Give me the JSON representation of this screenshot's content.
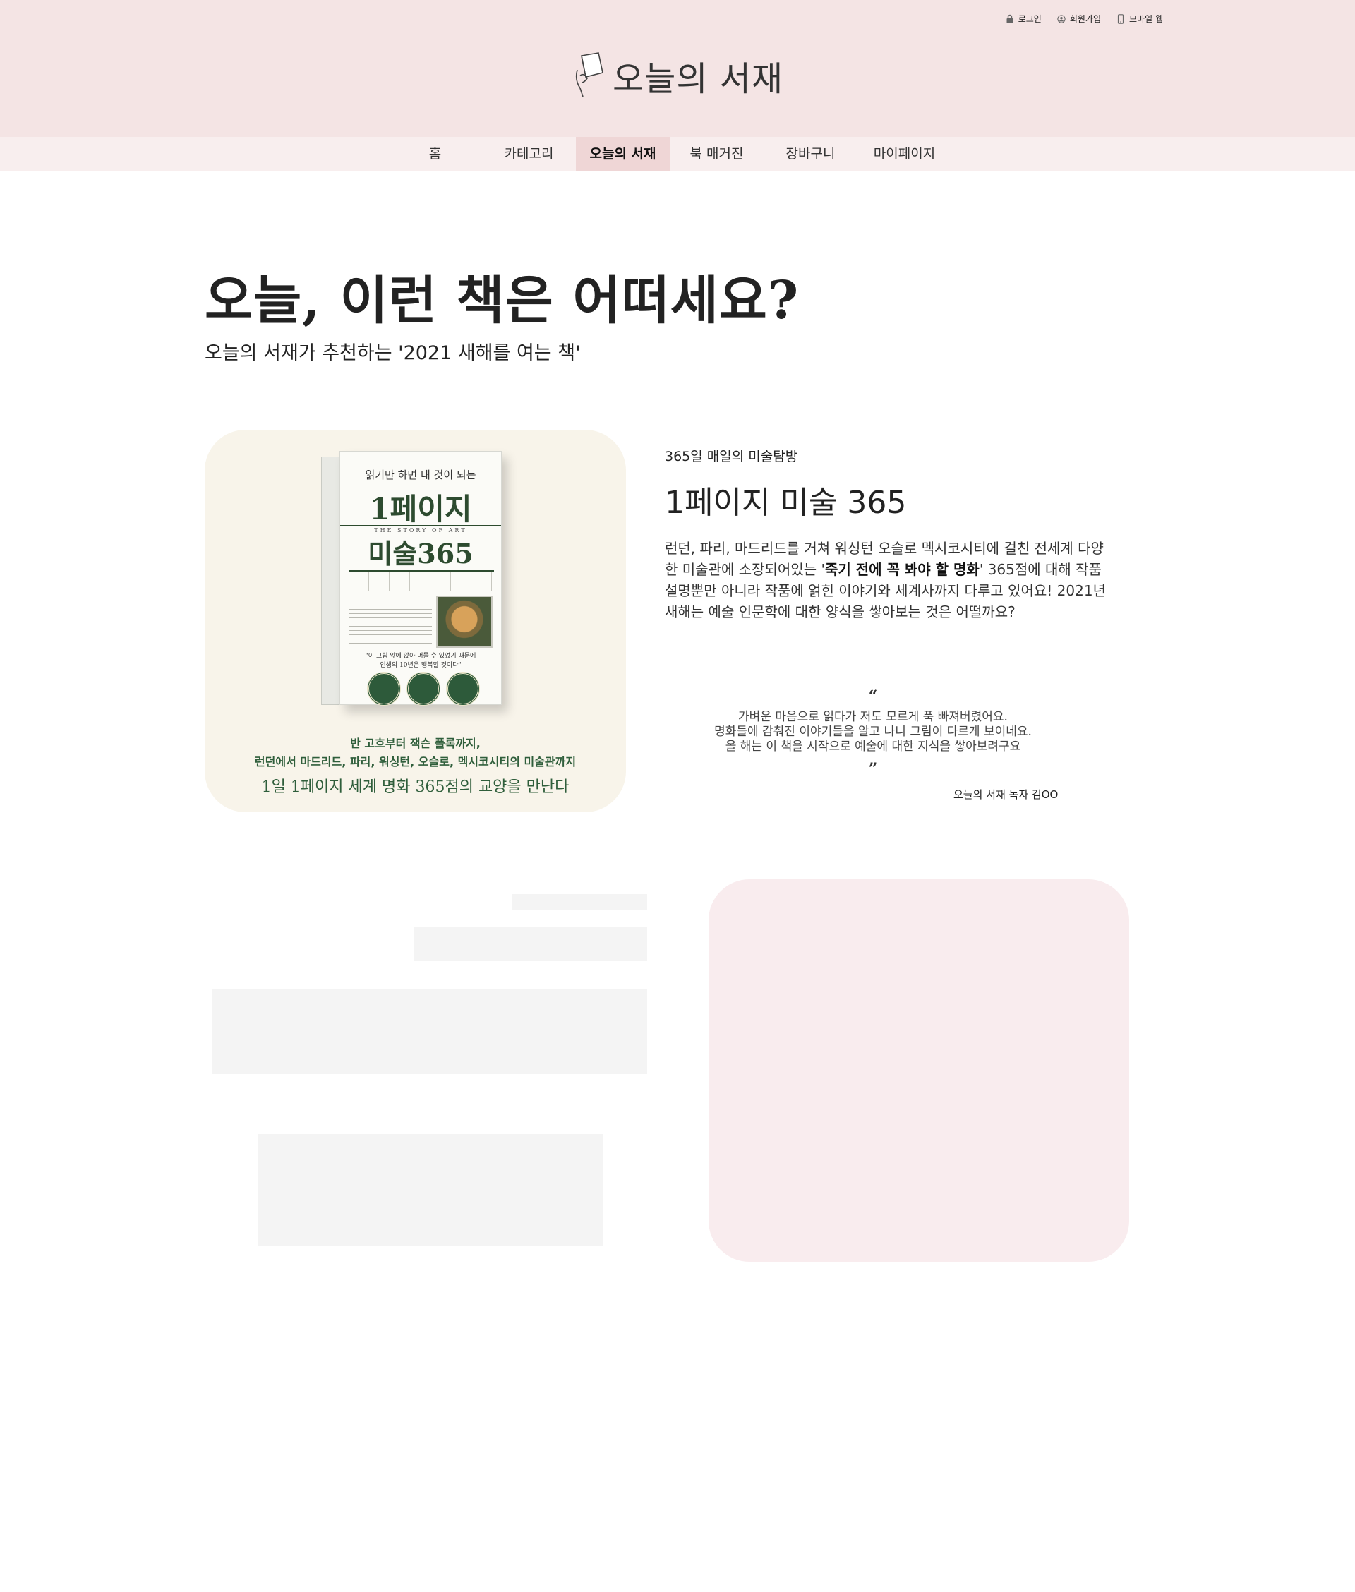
{
  "utility": {
    "login": "로그인",
    "signup": "회원가입",
    "mobile": "모바일 웹"
  },
  "logo": {
    "text": "오늘의 서재",
    "icon": "book-hand-icon"
  },
  "nav": {
    "items": [
      {
        "label": "홈"
      },
      {
        "label": "카테고리"
      },
      {
        "label": "오늘의 서재",
        "active": true
      },
      {
        "label": "북 매거진"
      },
      {
        "label": "장바구니"
      },
      {
        "label": "마이페이지"
      }
    ]
  },
  "hero": {
    "headline": "오늘, 이런 책은 어떠세요?",
    "subline": "오늘의 서재가 추천하는 '2021 새해를 여는 책'"
  },
  "book_cover": {
    "top_line": "읽기만 하면 내 것이 되는",
    "title_line1": "1페이지",
    "subtitle": "THE STORY OF ART",
    "title_line2": "미술365",
    "quote": "\"이 그림 앞에 앉아 머물 수 있었기 때문에\n인생의 10년은 행복할 것이다\"",
    "promo_line1": "반 고흐부터 잭슨 폴록까지,",
    "promo_line2": "런던에서 마드리드, 파리, 워싱턴, 오슬로, 멕시코시티의 미술관까지",
    "promo_line3": "1일 1페이지 세계 명화 365점의 교양을 만난다"
  },
  "book": {
    "kicker": "365일 매일의 미술탐방",
    "title": "1페이지 미술 365",
    "desc_part1": "런던, 파리, 마드리드를 거쳐 워싱턴 오슬로 멕시코시티에 걸친 전세계 다양한 미술관에 소장되어있는 '",
    "desc_bold": "죽기 전에 꼭 봐야 할 명화",
    "desc_part2": "' 365점에 대해 작품 설명뿐만 아니라 작품에 얽힌 이야기와 세계사까지 다루고 있어요! 2021년 새해는 예술 인문학에 대한 양식을 쌓아보는 것은 어떨까요?"
  },
  "review": {
    "open_quote": "“",
    "line1": "가벼운 마음으로 읽다가 저도 모르게 푹 빠져버렸어요.",
    "line2": "명화들에 감춰진 이야기들을 알고 나니 그림이 다르게 보이네요.",
    "line3": "올 해는 이 책을 시작으로 예술에 대한 지식을 쌓아보려구요",
    "close_quote": "”",
    "reviewer": "오늘의 서재 독자 김OO"
  },
  "colors": {
    "header_bg": "#f4e4e4",
    "nav_bg": "#f8eeee",
    "nav_active": "#efd6d6",
    "placeholder": "#f4f4f4",
    "pink_card": "#f9ecee",
    "book_green": "#2d4b2f"
  }
}
